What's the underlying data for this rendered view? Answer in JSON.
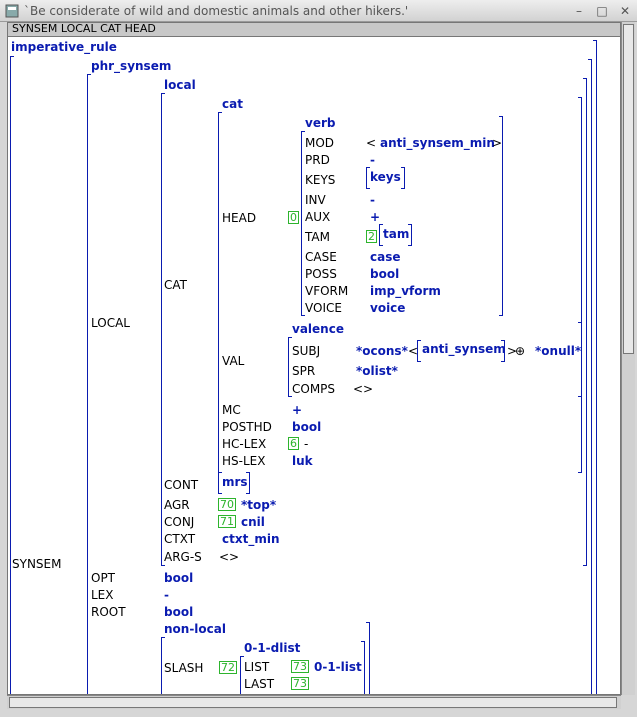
{
  "window": {
    "title": "`Be considerate of wild and domestic animals and other hikers.'"
  },
  "path_label": "SYNSEM LOCAL CAT HEAD",
  "avm": {
    "root_type": "imperative_rule",
    "synsem_label": "SYNSEM",
    "synsem_type": "phr_synsem",
    "local_label": "LOCAL",
    "local_type": "local",
    "cat_label": "CAT",
    "cat_type": "cat",
    "head_label": "HEAD",
    "head_tag": "0",
    "head_type": "verb",
    "head_features": [
      {
        "name": "MOD",
        "value": "anti_synsem_min"
      },
      {
        "name": "PRD",
        "value": "-"
      },
      {
        "name": "KEYS",
        "value": "keys"
      },
      {
        "name": "INV",
        "value": "-"
      },
      {
        "name": "AUX",
        "value": "+"
      },
      {
        "name": "TAM",
        "tag": "2",
        "value": "tam"
      },
      {
        "name": "CASE",
        "value": "case"
      },
      {
        "name": "POSS",
        "value": "bool"
      },
      {
        "name": "VFORM",
        "value": "imp_vform"
      },
      {
        "name": "VOICE",
        "value": "voice"
      }
    ],
    "val_label": "VAL",
    "val_type": "valence",
    "val_features": {
      "subj_name": "SUBJ",
      "subj_first": "*ocons*",
      "subj_inner": "anti_synsem",
      "subj_rest": "*onull*",
      "oplus": "⊕",
      "spr_name": "SPR",
      "spr_value": "*olist*",
      "comps_name": "COMPS"
    },
    "cat_features": [
      {
        "name": "MC",
        "value": "+"
      },
      {
        "name": "POSTHD",
        "value": "bool"
      },
      {
        "name": "HC-LEX",
        "tag": "6",
        "value": "-"
      },
      {
        "name": "HS-LEX",
        "value": "luk"
      }
    ],
    "local_features": [
      {
        "name": "CONT",
        "value": "mrs"
      },
      {
        "name": "AGR",
        "tag": "70",
        "value": "*top*"
      },
      {
        "name": "CONJ",
        "tag": "71",
        "value": "cnil"
      },
      {
        "name": "CTXT",
        "value": "ctxt_min"
      },
      {
        "name": "ARG-S",
        "value": ""
      }
    ],
    "synsem_features": [
      {
        "name": "OPT",
        "value": "bool"
      },
      {
        "name": "LEX",
        "value": "-"
      },
      {
        "name": "ROOT",
        "value": "bool"
      }
    ],
    "nonlocal_type": "non-local",
    "slash_label": "SLASH",
    "slash_tag": "72",
    "slash_type": "0-1-dlist",
    "slash_list": {
      "name": "LIST",
      "tag": "73",
      "value": "0-1-list"
    },
    "slash_last": {
      "name": "LAST",
      "tag": "73"
    }
  },
  "icons": {
    "app": "lkb-window-icon",
    "close": "close-icon",
    "minimize": "minimize-icon",
    "maximize": "maximize-icon"
  }
}
